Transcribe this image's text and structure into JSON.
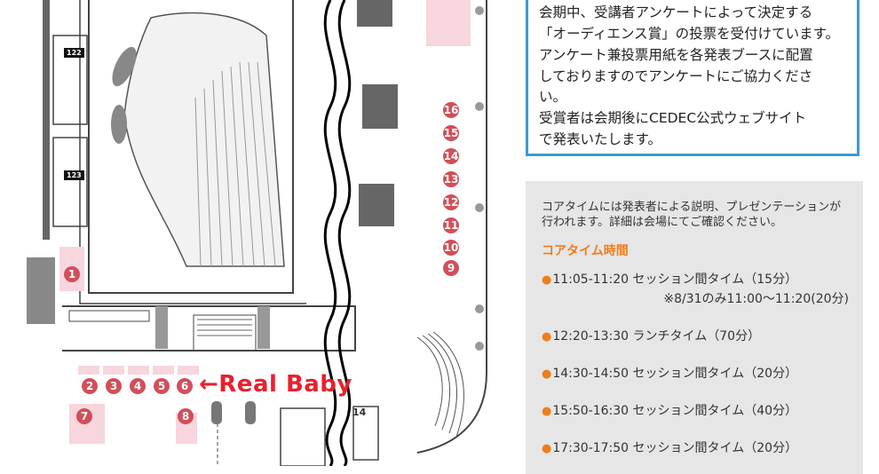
{
  "map": {
    "room_labels": [
      "122",
      "123"
    ],
    "markers": [
      "1",
      "2",
      "3",
      "4",
      "5",
      "6",
      "7",
      "8",
      "9",
      "10",
      "11",
      "12",
      "13",
      "14",
      "15",
      "16"
    ],
    "floating_text": "14",
    "callout": "←Real Baby",
    "colors": {
      "marker": "#d0505a",
      "booth": "#f7d6dd",
      "wall": "#555555",
      "callout": "#e8202e"
    }
  },
  "info": {
    "lines": [
      "会期中、受講者アンケートによって決定する",
      "「オーディエンス賞」の投票を受付けています。",
      "アンケート兼投票用紙を各発表ブースに配置",
      "しておりますのでアンケートにご協力くださ",
      "い。",
      "受賞者は会期後にCEDEC公式ウェブサイト",
      "で発表いたします。"
    ],
    "border_color": "#3e99d2"
  },
  "coretime": {
    "description": "コアタイムには発表者による説明、プレゼンテーションが行われます。詳細は会場にてご確認ください。",
    "title": "コアタイム時間",
    "items": [
      {
        "text": "11:05-11:20 セッション間タイム（15分）",
        "note": "※8/31のみ11:00〜11:20(20分)"
      },
      {
        "text": "12:20-13:30 ランチタイム（70分）",
        "note": ""
      },
      {
        "text": "14:30-14:50 セッション間タイム（20分）",
        "note": ""
      },
      {
        "text": "15:50-16:30 セッション間タイム（40分）",
        "note": ""
      },
      {
        "text": "17:30-17:50 セッション間タイム（20分）",
        "note": ""
      }
    ],
    "accent": "#ef7d1a"
  }
}
